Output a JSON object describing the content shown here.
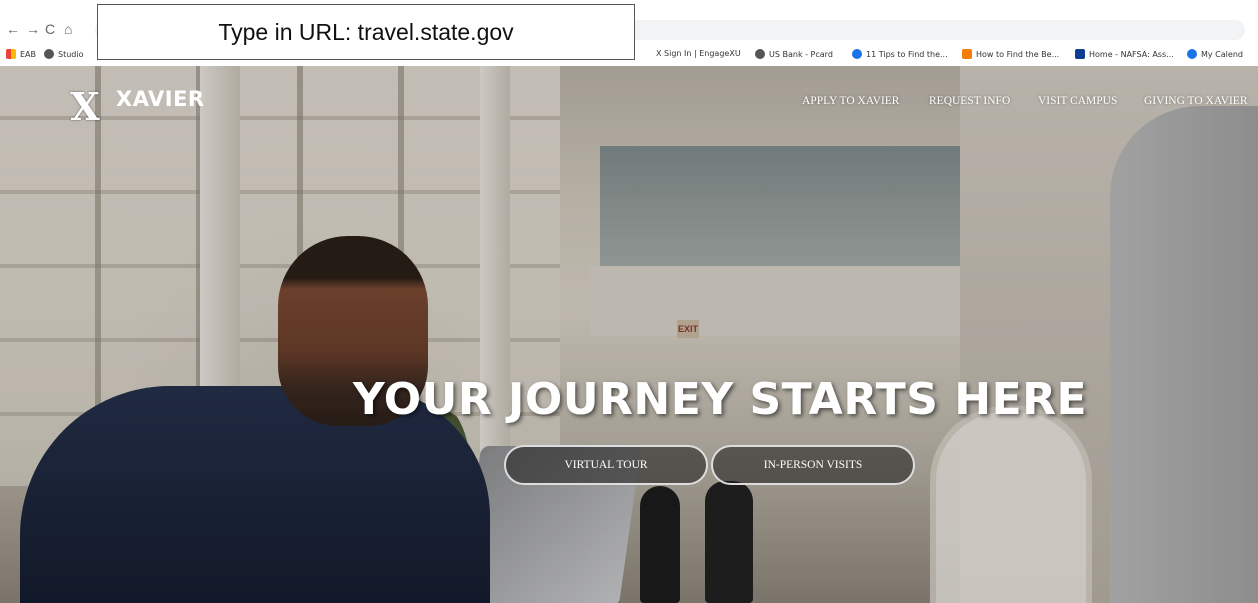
{
  "callout": {
    "text": "Type in URL: travel.state.gov"
  },
  "browser": {
    "nav_icons": [
      "back-arrow-icon",
      "forward-arrow-icon",
      "reload-icon",
      "home-icon"
    ],
    "nav_glyphs": [
      "←",
      "→",
      "C",
      "⌂"
    ],
    "bookmarks": [
      {
        "label": "EAB",
        "icon": "apps-grid-icon"
      },
      {
        "label": "Studio",
        "icon": "globe-icon"
      },
      {
        "label": "X Sign In | EngageXU",
        "icon": "xavier-x-icon"
      },
      {
        "label": "US Bank - Pcard",
        "icon": "globe-icon"
      },
      {
        "label": "11 Tips to Find the...",
        "icon": "bookmark-icon"
      },
      {
        "label": "How to Find the Be...",
        "icon": "link-icon"
      },
      {
        "label": "Home - NAFSA: Ass...",
        "icon": "nafsa-icon"
      },
      {
        "label": "My Calend",
        "icon": "calendar-icon"
      }
    ]
  },
  "site": {
    "logo_mark": "X",
    "logo_text": "XAVIER",
    "nav": [
      "APPLY TO XAVIER",
      "REQUEST INFO",
      "VISIT CAMPUS",
      "GIVING TO XAVIER"
    ],
    "headline": "YOUR JOURNEY STARTS HERE",
    "buttons": [
      "VIRTUAL TOUR",
      "IN-PERSON VISITS"
    ],
    "exit_sign": "EXIT"
  },
  "colors": {
    "nav_text": "#ffffff",
    "button_bg": "rgba(25,25,25,0.55)"
  }
}
